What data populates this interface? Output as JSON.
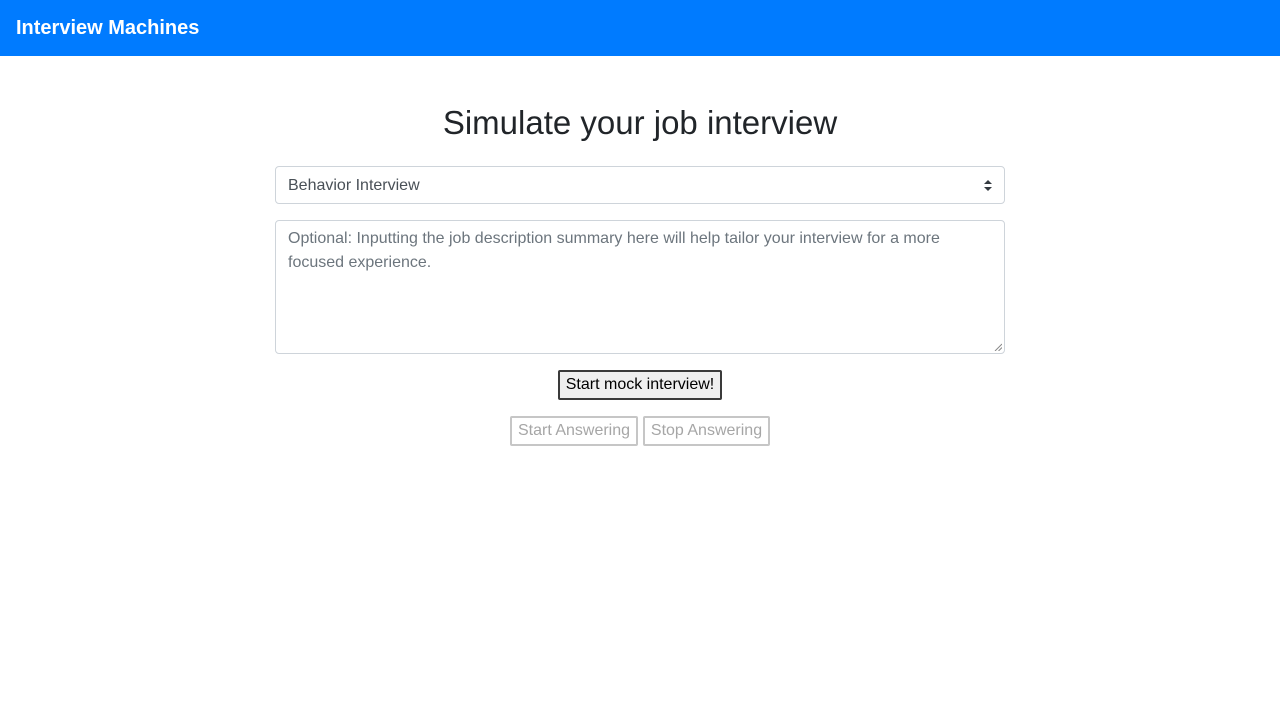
{
  "navbar": {
    "brand": "Interview Machines",
    "background": "#007bff"
  },
  "main": {
    "title": "Simulate your job interview",
    "interview_type": {
      "selected": "Behavior Interview"
    },
    "job_description": {
      "value": "",
      "placeholder": "Optional: Inputting the job description summary here will help tailor your interview for a more focused experience."
    },
    "start_mock_label": "Start mock interview!",
    "start_answering_label": "Start Answering",
    "stop_answering_label": "Stop Answering"
  }
}
